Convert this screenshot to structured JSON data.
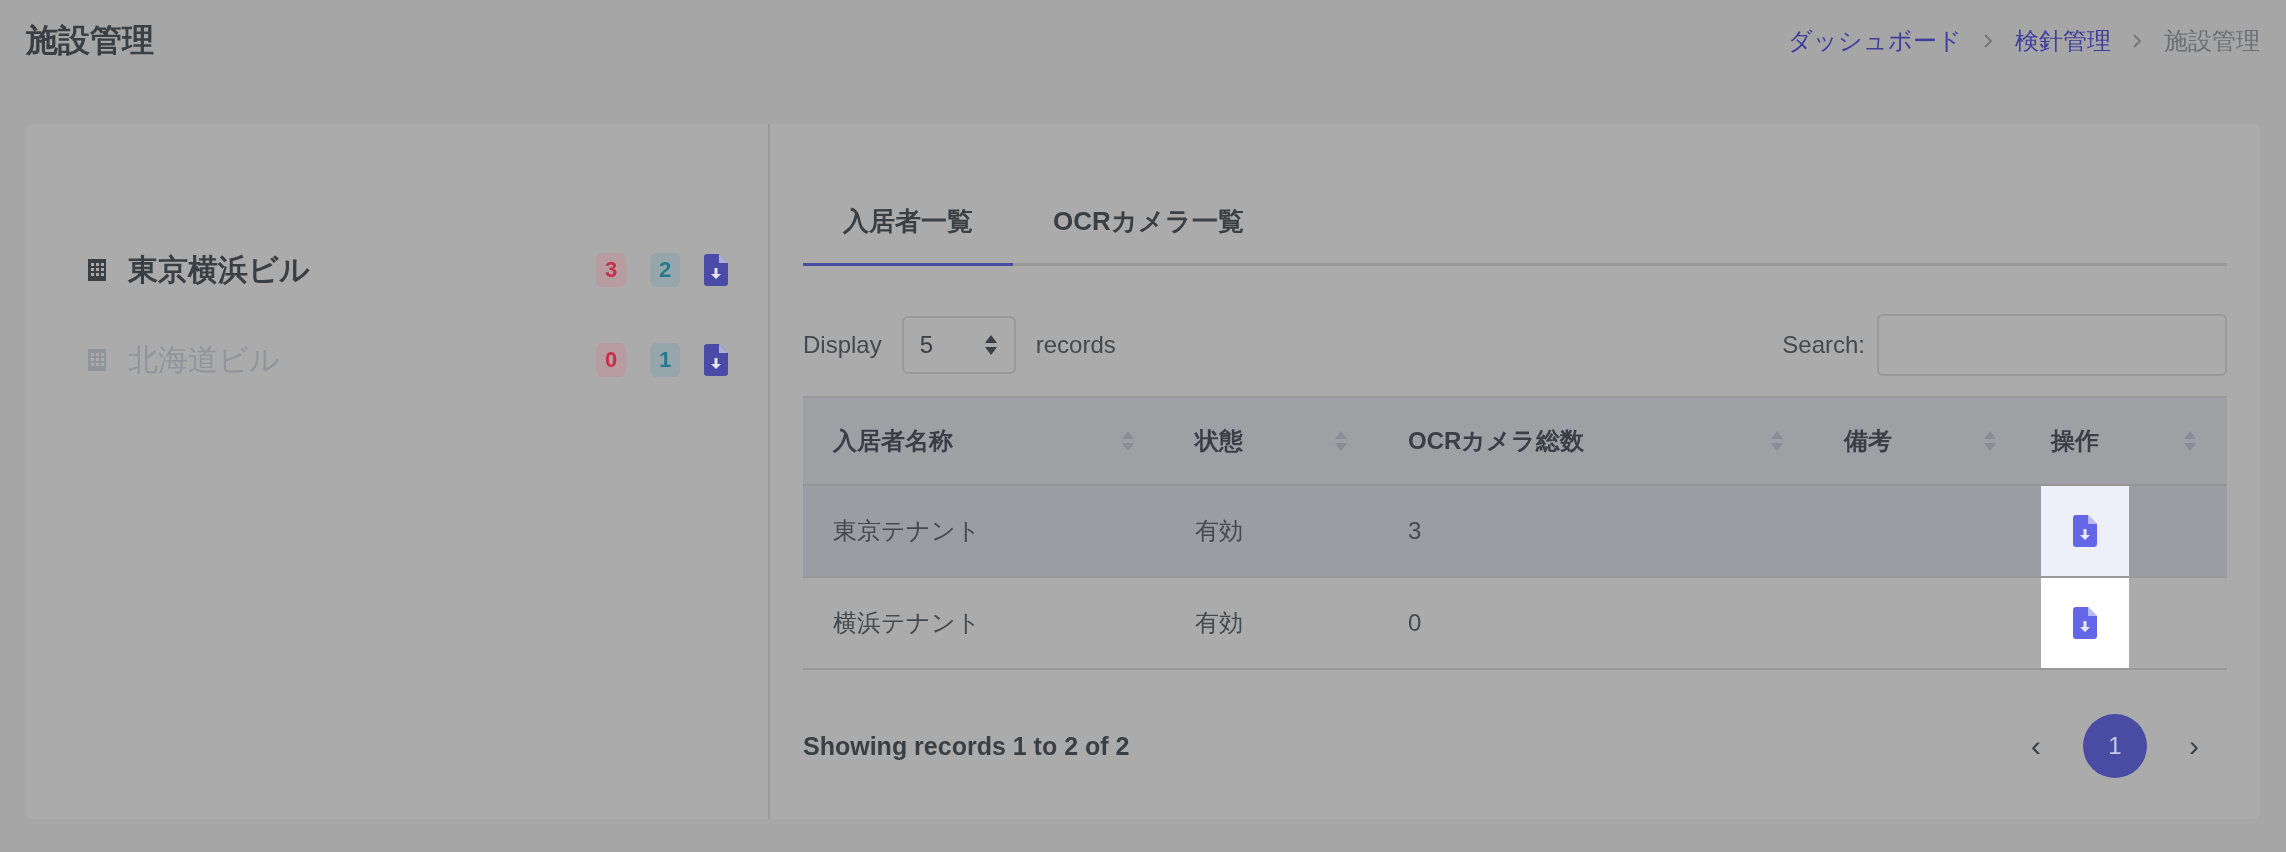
{
  "page_title": "施設管理",
  "breadcrumb": [
    {
      "label": "ダッシュボード",
      "current": false
    },
    {
      "label": "検針管理",
      "current": false
    },
    {
      "label": "施設管理",
      "current": true
    }
  ],
  "facilities": [
    {
      "name": "東京横浜ビル",
      "selected": true,
      "alert_count": "3",
      "info_count": "2"
    },
    {
      "name": "北海道ビル",
      "selected": false,
      "alert_count": "0",
      "info_count": "1"
    }
  ],
  "tabs": [
    {
      "label": "入居者一覧",
      "selected": true
    },
    {
      "label": "OCRカメラ一覧",
      "selected": false
    }
  ],
  "length_control": {
    "prefix": "Display",
    "value": "5",
    "suffix": "records"
  },
  "search": {
    "label": "Search:"
  },
  "table": {
    "columns": [
      "入居者名称",
      "状態",
      "OCRカメラ総数",
      "備考",
      "操作"
    ],
    "rows": [
      {
        "cells": [
          "東京テナント",
          "有効",
          "3",
          ""
        ],
        "highlighted": true
      },
      {
        "cells": [
          "横浜テナント",
          "有効",
          "0",
          ""
        ],
        "highlighted": false
      }
    ]
  },
  "footer": {
    "info": "Showing records 1 to 2 of 2",
    "prev": "‹",
    "next": "›",
    "pages": [
      {
        "label": "1",
        "selected": true
      }
    ]
  }
}
